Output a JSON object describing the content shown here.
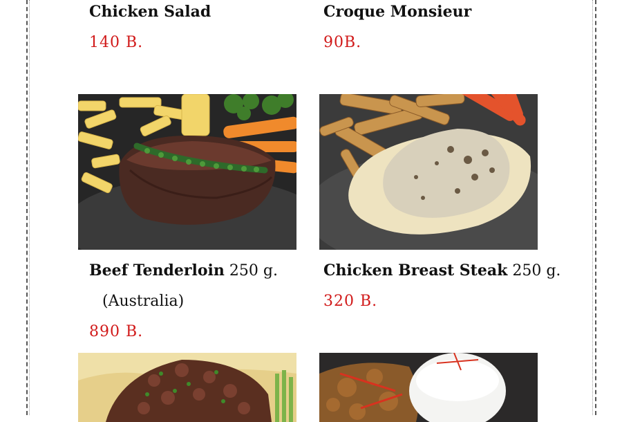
{
  "items": [
    {
      "name": "Chicken Salad",
      "price": "140 B."
    },
    {
      "name": "Croque Monsieur",
      "price": "90B."
    },
    {
      "name": "Beef Tenderloin",
      "weight": "250 g.",
      "note": "(Australia)",
      "price": "890 B."
    },
    {
      "name": "Chicken Breast Steak",
      "weight": "250 g.",
      "price": "320 B."
    }
  ],
  "colors": {
    "price": "#d11a1a",
    "text": "#111111",
    "border": "#555555"
  }
}
